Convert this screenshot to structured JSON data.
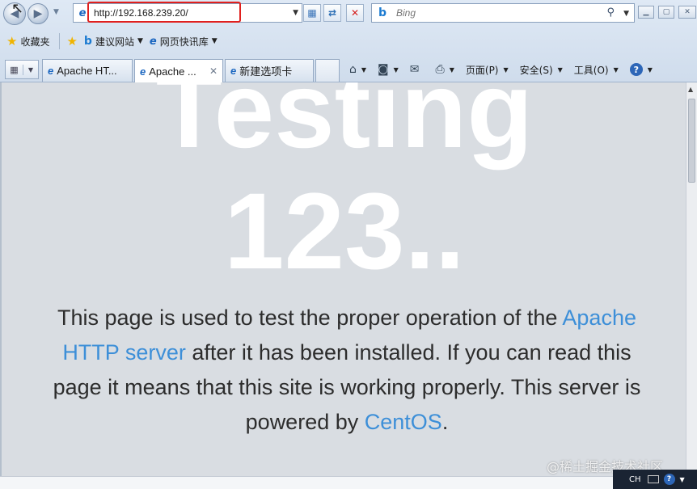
{
  "address_bar": {
    "url": "http://192.168.239.20/"
  },
  "search": {
    "placeholder": "Bing"
  },
  "favorites_bar": {
    "favorites_label": "收藏夹",
    "items": [
      {
        "label": "建议网站"
      },
      {
        "label": "网页快讯库"
      }
    ]
  },
  "tabs": [
    {
      "label": "Apache HT..."
    },
    {
      "label": "Apache ..."
    },
    {
      "label": "新建选项卡"
    }
  ],
  "command_bar": {
    "page_label": "页面(P)",
    "safety_label": "安全(S)",
    "tools_label": "工具(O)"
  },
  "page": {
    "heading_line1": "Testing",
    "heading_line2": "123..",
    "para_1": "This page is used to test the proper operation of the",
    "link_apache": "Apache HTTP server",
    "para_2": "after it has been installed. If you can read this page it means that this site is working properly. This server is powered by",
    "link_centos": "CentOS",
    "para_end": "."
  },
  "watermark": "@稀土掘金技术社区",
  "taskbar": {
    "lang": "CH"
  },
  "colors": {
    "link": "#3d8fd8",
    "background": "#d9dde2",
    "highlight": "#e0201e"
  }
}
